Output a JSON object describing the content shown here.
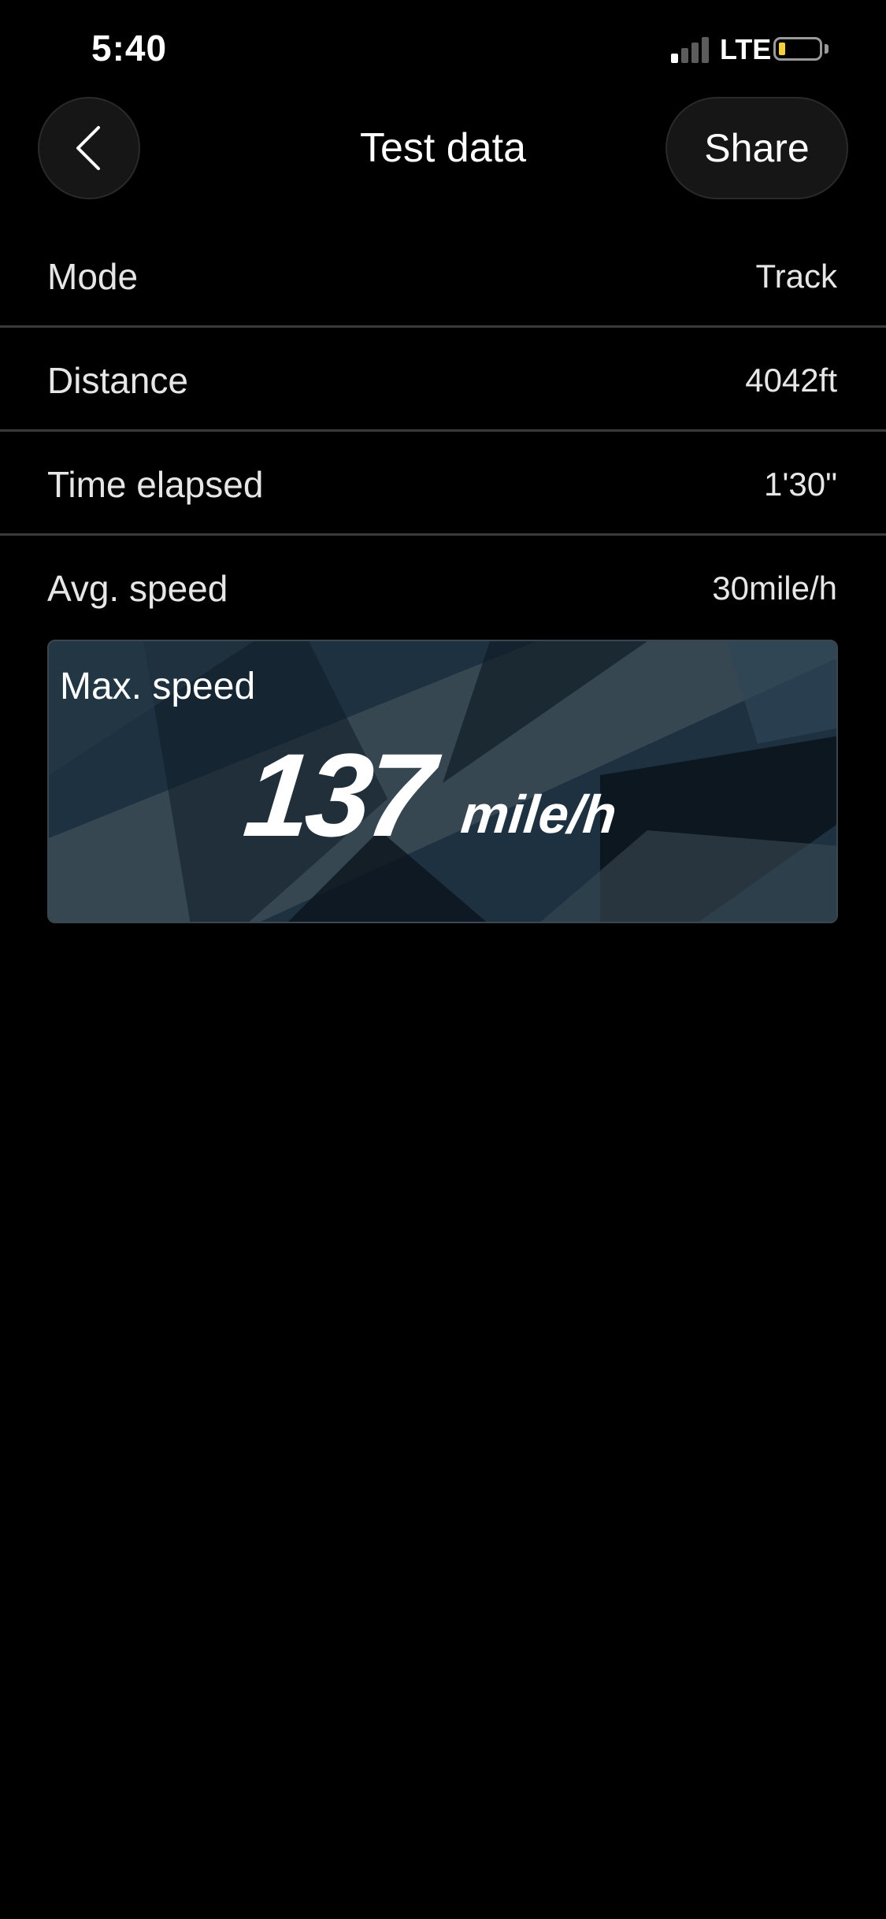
{
  "status_bar": {
    "time": "5:40",
    "network": "LTE"
  },
  "header": {
    "title": "Test data",
    "back_icon": "chevron-left-icon",
    "share_label": "Share"
  },
  "rows": [
    {
      "label": "Mode",
      "value": "Track"
    },
    {
      "label": "Distance",
      "value": "4042ft"
    },
    {
      "label": "Time elapsed",
      "value": "1'30\""
    },
    {
      "label": "Avg. speed",
      "value": "30mile/h"
    }
  ],
  "max_speed": {
    "label": "Max. speed",
    "value": "137",
    "unit": "mile/h"
  },
  "colors": {
    "background": "#000000",
    "card_background": "#1c2c38",
    "battery_level": "#f4d03f",
    "divider": "#3a3a3a"
  }
}
